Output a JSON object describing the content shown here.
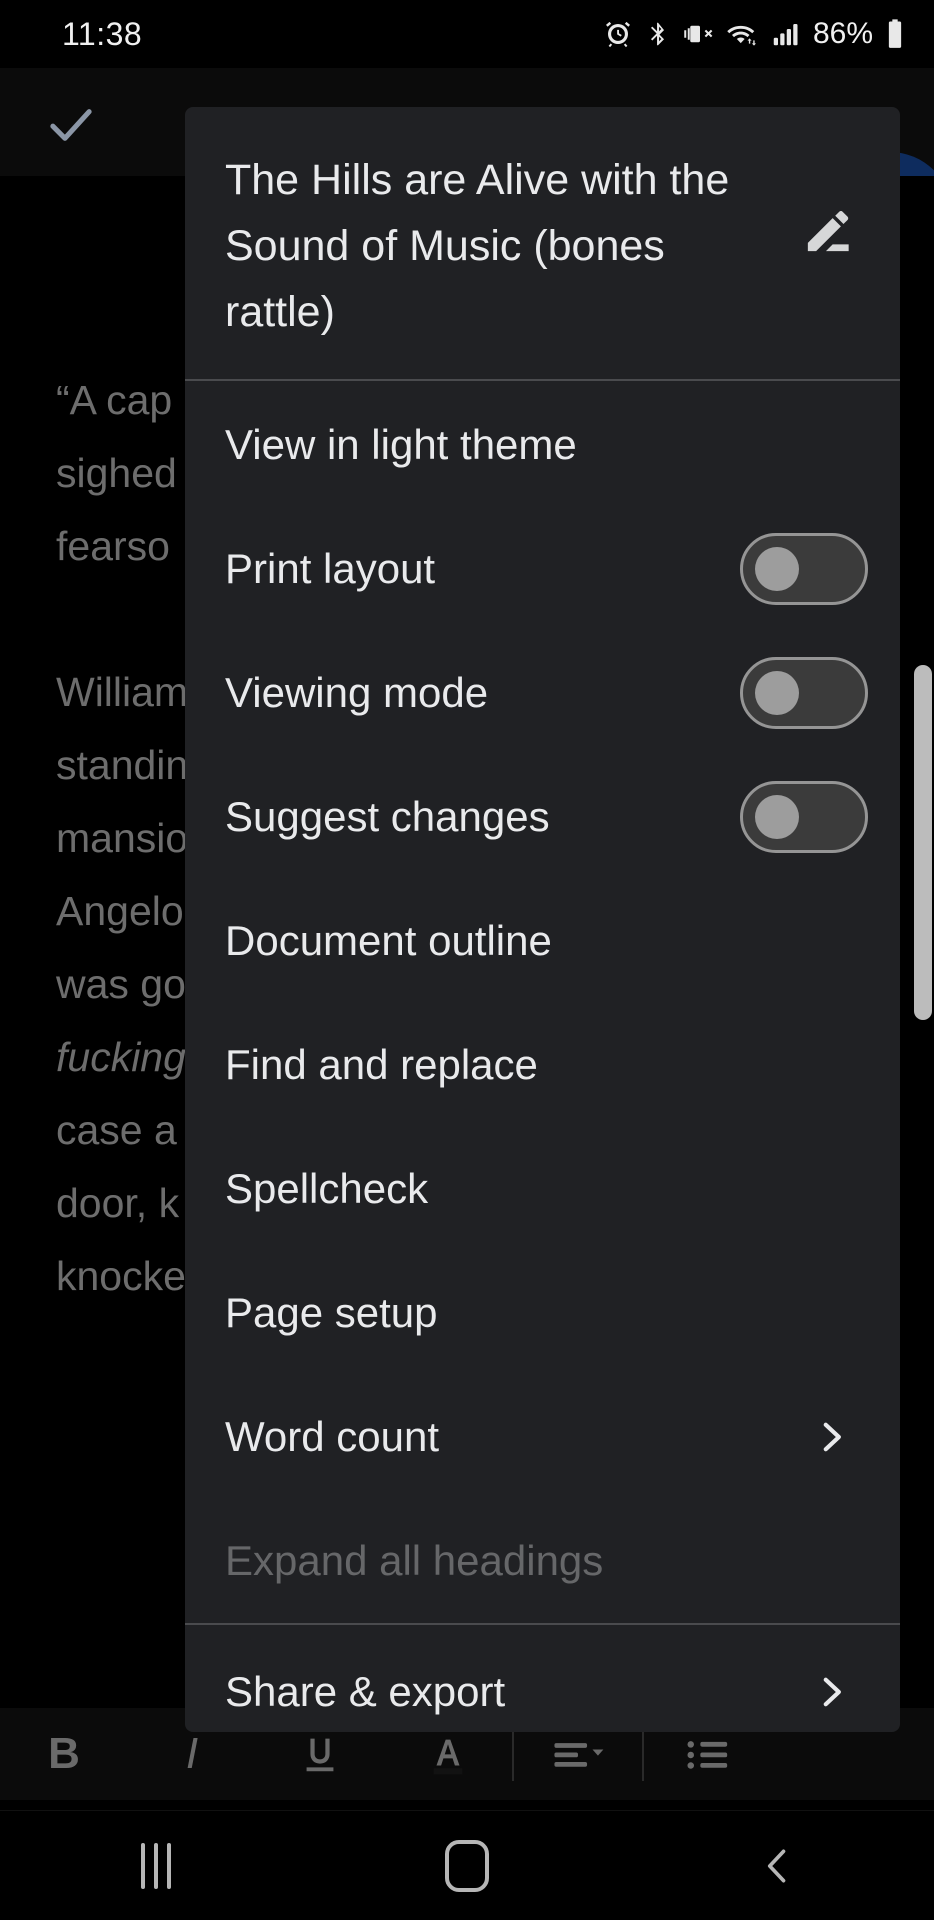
{
  "status_bar": {
    "time": "11:38",
    "battery_text": "86%",
    "icons": [
      "alarm-icon",
      "bluetooth-icon",
      "vibrate-icon",
      "wifi-icon",
      "cellular-signal-icon",
      "battery-icon"
    ]
  },
  "app": {
    "accept_icon": "check-icon",
    "fab_color": "#0e2c5e",
    "document_text": [
      "“A cap…\nsighed…\nfearso…",
      "William…\nstandin…\nmansio…\nAngelo…\nwas go…"
    ],
    "document_lines": [
      "“A cap",
      "sighed",
      "fearso",
      "William",
      "standin",
      "mansio",
      "Angelo",
      "was go",
      "fucking",
      "case a",
      "door, k",
      "knocke"
    ],
    "format_toolbar": [
      {
        "name": "bold-button",
        "glyph": "B",
        "style": "bold"
      },
      {
        "name": "italic-button",
        "glyph": "I",
        "style": "italic"
      },
      {
        "name": "underline-button",
        "glyph": "U",
        "style": "underline"
      },
      {
        "name": "text-color-button",
        "glyph": "A",
        "style": "color"
      },
      {
        "name": "align-button",
        "glyph": "align",
        "style": "align"
      },
      {
        "name": "list-button",
        "glyph": "list",
        "style": "list"
      }
    ]
  },
  "menu": {
    "title": "The Hills are Alive with the Sound of Music (bones rattle)",
    "edit_title_icon": "pencil-edit-icon",
    "items": [
      {
        "label": "View in light theme",
        "type": "plain",
        "name": "menu-item-view-in-light-theme",
        "disabled": false
      },
      {
        "label": "Print layout",
        "type": "toggle",
        "name": "menu-item-print-layout",
        "value": "off",
        "disabled": false
      },
      {
        "label": "Viewing mode",
        "type": "toggle",
        "name": "menu-item-viewing-mode",
        "value": "off",
        "disabled": false
      },
      {
        "label": "Suggest changes",
        "type": "toggle",
        "name": "menu-item-suggest-changes",
        "value": "off",
        "disabled": false
      },
      {
        "label": "Document outline",
        "type": "plain",
        "name": "menu-item-document-outline",
        "disabled": false
      },
      {
        "label": "Find and replace",
        "type": "plain",
        "name": "menu-item-find-and-replace",
        "disabled": false
      },
      {
        "label": "Spellcheck",
        "type": "plain",
        "name": "menu-item-spellcheck",
        "disabled": false
      },
      {
        "label": "Page setup",
        "type": "plain",
        "name": "menu-item-page-setup",
        "disabled": false
      },
      {
        "label": "Word count",
        "type": "submenu",
        "name": "menu-item-word-count",
        "disabled": false
      },
      {
        "label": "Expand all headings",
        "type": "plain",
        "name": "menu-item-expand-all-headings",
        "disabled": true
      },
      {
        "label": "Share & export",
        "type": "submenu",
        "name": "menu-item-share-and-export",
        "disabled": false
      }
    ],
    "background_color": "#202124",
    "text_color": "#e9eaec",
    "disabled_text_color": "#666769"
  },
  "nav_bar": {
    "recents_label": "recents-button",
    "home_label": "home-button",
    "back_label": "back-button"
  }
}
